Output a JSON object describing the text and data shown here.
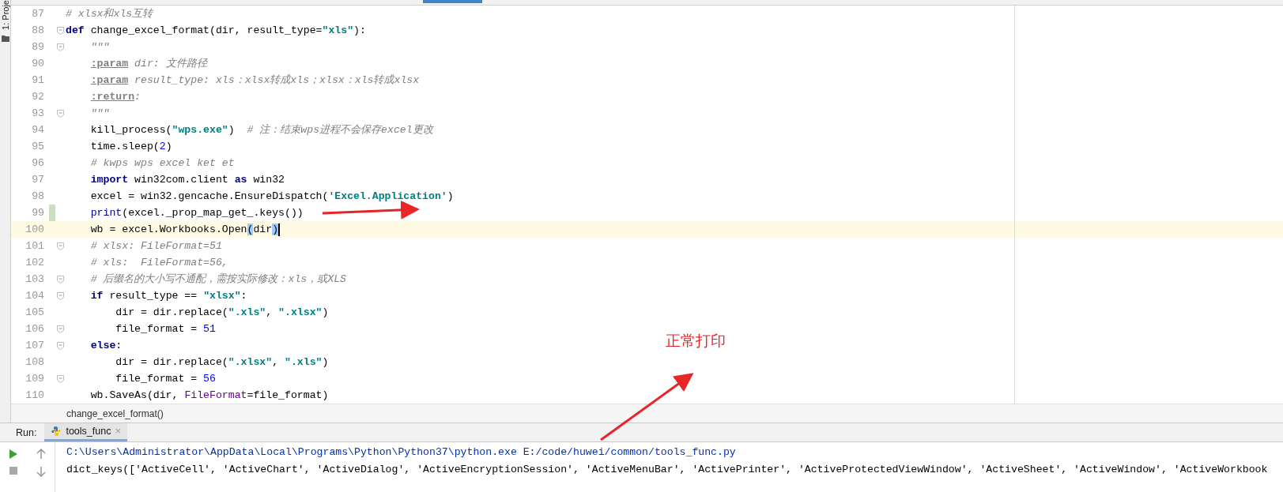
{
  "tool_strip": {
    "label": "1: Proje"
  },
  "editor": {
    "lines": [
      {
        "number": "87",
        "fold": false,
        "modified": false,
        "current": false,
        "tokens": [
          {
            "kind": "cmt",
            "text": "# xlsx和xls互转"
          }
        ]
      },
      {
        "number": "88",
        "fold": true,
        "modified": false,
        "current": false,
        "tokens": [
          {
            "kind": "kw",
            "text": "def"
          },
          {
            "kind": "plain",
            "text": " change_excel_format(dir, result_type="
          },
          {
            "kind": "str",
            "text": "\"xls\""
          },
          {
            "kind": "plain",
            "text": "):"
          }
        ]
      },
      {
        "number": "89",
        "fold": true,
        "modified": false,
        "current": false,
        "tokens": [
          {
            "kind": "doc",
            "text": "    \"\"\""
          }
        ]
      },
      {
        "number": "90",
        "fold": false,
        "modified": false,
        "current": false,
        "tokens": [
          {
            "kind": "tag",
            "text": "    :param"
          },
          {
            "kind": "doc",
            "text": " dir: 文件路径"
          }
        ]
      },
      {
        "number": "91",
        "fold": false,
        "modified": false,
        "current": false,
        "tokens": [
          {
            "kind": "tag",
            "text": "    :param"
          },
          {
            "kind": "doc",
            "text": " result_type: xls：xlsx转成xls；xlsx：xls转成xlsx"
          }
        ]
      },
      {
        "number": "92",
        "fold": false,
        "modified": false,
        "current": false,
        "tokens": [
          {
            "kind": "tag",
            "text": "    :return"
          },
          {
            "kind": "doc",
            "text": ":"
          }
        ]
      },
      {
        "number": "93",
        "fold": true,
        "modified": false,
        "current": false,
        "tokens": [
          {
            "kind": "doc",
            "text": "    \"\"\""
          }
        ]
      },
      {
        "number": "94",
        "fold": false,
        "modified": false,
        "current": false,
        "tokens": [
          {
            "kind": "plain",
            "text": "    kill_process("
          },
          {
            "kind": "str",
            "text": "\"wps.exe\""
          },
          {
            "kind": "plain",
            "text": ")  "
          },
          {
            "kind": "cmt",
            "text": "# 注：结束wps进程不会保存excel更改"
          }
        ]
      },
      {
        "number": "95",
        "fold": false,
        "modified": false,
        "current": false,
        "tokens": [
          {
            "kind": "plain",
            "text": "    time.sleep("
          },
          {
            "kind": "num",
            "text": "2"
          },
          {
            "kind": "plain",
            "text": ")"
          }
        ]
      },
      {
        "number": "96",
        "fold": false,
        "modified": false,
        "current": false,
        "tokens": [
          {
            "kind": "cmt",
            "text": "    # kwps wps excel ket et"
          }
        ]
      },
      {
        "number": "97",
        "fold": false,
        "modified": false,
        "current": false,
        "tokens": [
          {
            "kind": "kw",
            "text": "    import"
          },
          {
            "kind": "plain",
            "text": " win32com.client "
          },
          {
            "kind": "kw",
            "text": "as"
          },
          {
            "kind": "plain",
            "text": " win32"
          }
        ]
      },
      {
        "number": "98",
        "fold": false,
        "modified": false,
        "current": false,
        "tokens": [
          {
            "kind": "plain",
            "text": "    excel = win32.gencache.EnsureDispatch("
          },
          {
            "kind": "str",
            "text": "'Excel.Application'"
          },
          {
            "kind": "plain",
            "text": ")"
          }
        ]
      },
      {
        "number": "99",
        "fold": false,
        "modified": true,
        "current": false,
        "tokens": [
          {
            "kind": "builtin",
            "text": "    print"
          },
          {
            "kind": "plain",
            "text": "(excel._prop_map_get_.keys())"
          }
        ]
      },
      {
        "number": "100",
        "fold": false,
        "modified": false,
        "current": true,
        "tokens": [
          {
            "kind": "plain",
            "text": "    wb = excel.Workbooks.Open"
          },
          {
            "kind": "match",
            "text": "("
          },
          {
            "kind": "plain",
            "text": "dir"
          },
          {
            "kind": "match",
            "text": ")"
          }
        ]
      },
      {
        "number": "101",
        "fold": true,
        "modified": false,
        "current": false,
        "tokens": [
          {
            "kind": "cmt",
            "text": "    # xlsx: FileFormat=51"
          }
        ]
      },
      {
        "number": "102",
        "fold": false,
        "modified": false,
        "current": false,
        "tokens": [
          {
            "kind": "cmt",
            "text": "    # xls:  FileFormat=56,"
          }
        ]
      },
      {
        "number": "103",
        "fold": true,
        "modified": false,
        "current": false,
        "tokens": [
          {
            "kind": "cmt",
            "text": "    # 后缀名的大小写不通配，需按实际修改：xls，或XLS"
          }
        ]
      },
      {
        "number": "104",
        "fold": true,
        "modified": false,
        "current": false,
        "tokens": [
          {
            "kind": "kw",
            "text": "    if"
          },
          {
            "kind": "plain",
            "text": " result_type == "
          },
          {
            "kind": "str",
            "text": "\"xlsx\""
          },
          {
            "kind": "plain",
            "text": ":"
          }
        ]
      },
      {
        "number": "105",
        "fold": false,
        "modified": false,
        "current": false,
        "tokens": [
          {
            "kind": "plain",
            "text": "        dir = dir.replace("
          },
          {
            "kind": "str",
            "text": "\".xls\""
          },
          {
            "kind": "plain",
            "text": ", "
          },
          {
            "kind": "str",
            "text": "\".xlsx\""
          },
          {
            "kind": "plain",
            "text": ")"
          }
        ]
      },
      {
        "number": "106",
        "fold": true,
        "modified": false,
        "current": false,
        "tokens": [
          {
            "kind": "plain",
            "text": "        file_format = "
          },
          {
            "kind": "num",
            "text": "51"
          }
        ]
      },
      {
        "number": "107",
        "fold": true,
        "modified": false,
        "current": false,
        "tokens": [
          {
            "kind": "kw",
            "text": "    else"
          },
          {
            "kind": "plain",
            "text": ":"
          }
        ]
      },
      {
        "number": "108",
        "fold": false,
        "modified": false,
        "current": false,
        "tokens": [
          {
            "kind": "plain",
            "text": "        dir = dir.replace("
          },
          {
            "kind": "str",
            "text": "\".xlsx\""
          },
          {
            "kind": "plain",
            "text": ", "
          },
          {
            "kind": "str",
            "text": "\".xls\""
          },
          {
            "kind": "plain",
            "text": ")"
          }
        ]
      },
      {
        "number": "109",
        "fold": true,
        "modified": false,
        "current": false,
        "tokens": [
          {
            "kind": "plain",
            "text": "        file_format = "
          },
          {
            "kind": "num",
            "text": "56"
          }
        ]
      },
      {
        "number": "110",
        "fold": false,
        "modified": false,
        "current": false,
        "tokens": [
          {
            "kind": "plain",
            "text": "    wb.SaveAs(dir, "
          },
          {
            "kind": "param",
            "text": "FileFormat"
          },
          {
            "kind": "plain",
            "text": "=file_format)"
          }
        ]
      }
    ],
    "breadcrumb": "change_excel_format()"
  },
  "run_panel": {
    "label": "Run:",
    "tab": {
      "title": "tools_func",
      "close": "×"
    },
    "console": [
      "C:\\Users\\Administrator\\AppData\\Local\\Programs\\Python\\Python37\\python.exe E:/code/huwei/common/tools_func.py",
      "dict_keys(['ActiveCell', 'ActiveChart', 'ActiveDialog', 'ActiveEncryptionSession', 'ActiveMenuBar', 'ActivePrinter', 'ActiveProtectedViewWindow', 'ActiveSheet', 'ActiveWindow', 'ActiveWorkbook"
    ]
  },
  "annotation": {
    "label": "正常打印"
  }
}
